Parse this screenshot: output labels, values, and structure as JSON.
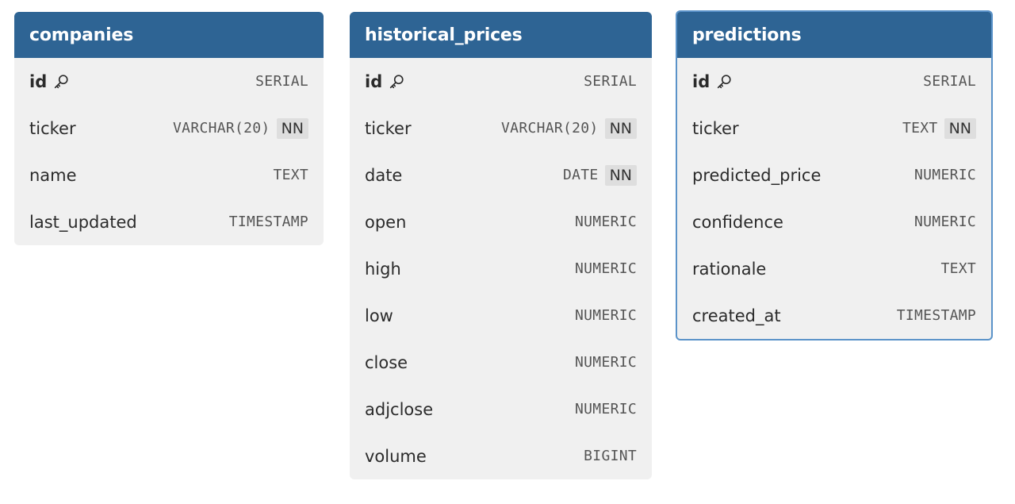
{
  "tables": [
    {
      "id": "companies",
      "title": "companies",
      "selected": false,
      "columns": [
        {
          "name": "id",
          "type": "SERIAL",
          "pk": true,
          "nn": ""
        },
        {
          "name": "ticker",
          "type": "VARCHAR(20)",
          "pk": false,
          "nn": "NN"
        },
        {
          "name": "name",
          "type": "TEXT",
          "pk": false,
          "nn": ""
        },
        {
          "name": "last_updated",
          "type": "TIMESTAMP",
          "pk": false,
          "nn": ""
        }
      ]
    },
    {
      "id": "historical-prices",
      "title": "historical_prices",
      "selected": false,
      "columns": [
        {
          "name": "id",
          "type": "SERIAL",
          "pk": true,
          "nn": ""
        },
        {
          "name": "ticker",
          "type": "VARCHAR(20)",
          "pk": false,
          "nn": "NN"
        },
        {
          "name": "date",
          "type": "DATE",
          "pk": false,
          "nn": "NN"
        },
        {
          "name": "open",
          "type": "NUMERIC",
          "pk": false,
          "nn": ""
        },
        {
          "name": "high",
          "type": "NUMERIC",
          "pk": false,
          "nn": ""
        },
        {
          "name": "low",
          "type": "NUMERIC",
          "pk": false,
          "nn": ""
        },
        {
          "name": "close",
          "type": "NUMERIC",
          "pk": false,
          "nn": ""
        },
        {
          "name": "adjclose",
          "type": "NUMERIC",
          "pk": false,
          "nn": ""
        },
        {
          "name": "volume",
          "type": "BIGINT",
          "pk": false,
          "nn": ""
        }
      ]
    },
    {
      "id": "predictions",
      "title": "predictions",
      "selected": true,
      "columns": [
        {
          "name": "id",
          "type": "SERIAL",
          "pk": true,
          "nn": ""
        },
        {
          "name": "ticker",
          "type": "TEXT",
          "pk": false,
          "nn": "NN"
        },
        {
          "name": "predicted_price",
          "type": "NUMERIC",
          "pk": false,
          "nn": ""
        },
        {
          "name": "confidence",
          "type": "NUMERIC",
          "pk": false,
          "nn": ""
        },
        {
          "name": "rationale",
          "type": "TEXT",
          "pk": false,
          "nn": ""
        },
        {
          "name": "created_at",
          "type": "TIMESTAMP",
          "pk": false,
          "nn": ""
        }
      ]
    }
  ],
  "icons": {
    "primary_key": "key-icon"
  },
  "colors": {
    "header": "#2e6494",
    "body": "#f0f0f0",
    "selected_border": "#5b93c9",
    "nn_badge": "#dedede"
  }
}
